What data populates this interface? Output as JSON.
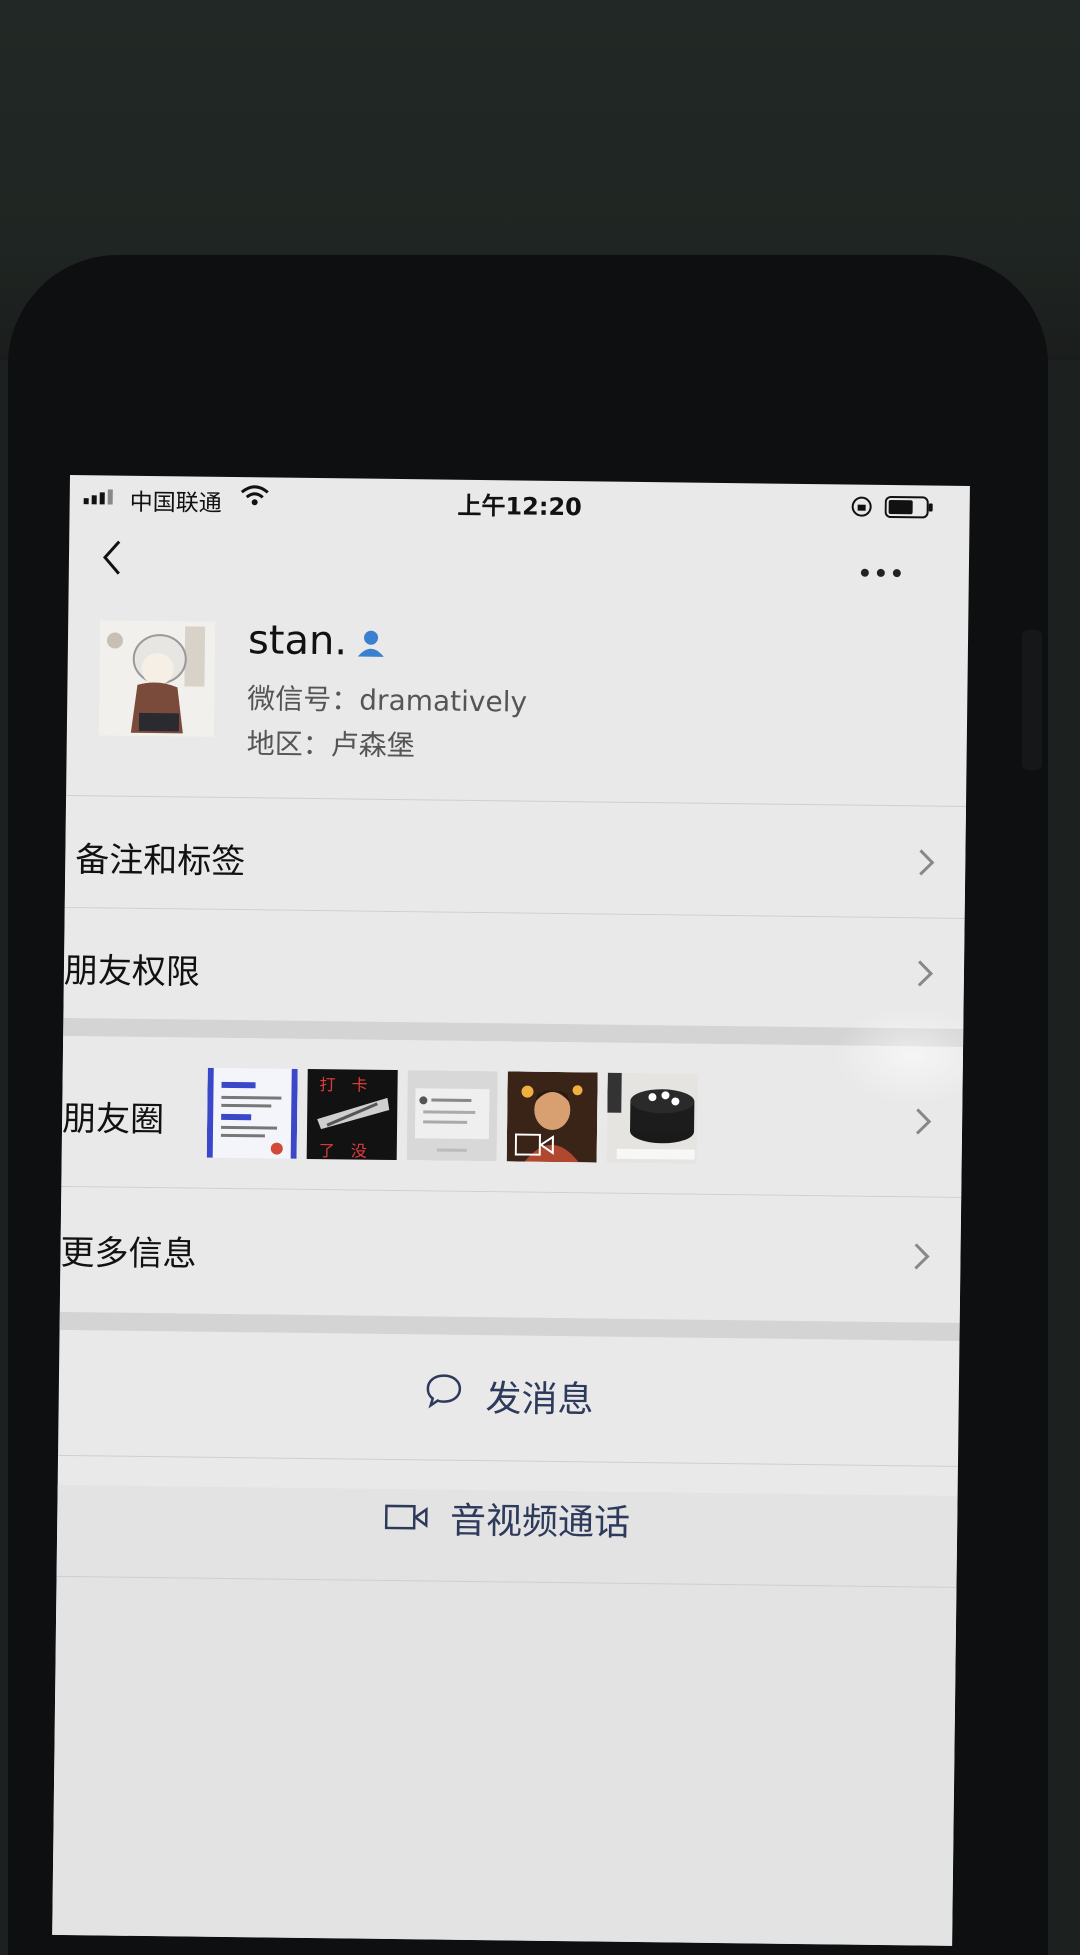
{
  "status_bar": {
    "carrier": "中国联通",
    "time": "上午12:20"
  },
  "profile": {
    "name": "stan.",
    "wechat_id": "微信号：dramatively",
    "region": "地区：卢森堡"
  },
  "menu": {
    "remark_tags": "备注和标签",
    "friend_permissions": "朋友权限",
    "moments": "朋友圈",
    "more_info": "更多信息"
  },
  "moments_thumbs": {
    "thumb2_text_top": "打　卡",
    "thumb2_text_bottom": "了　没"
  },
  "actions": {
    "send_message": "发消息",
    "video_call": "音视频通话"
  },
  "colors": {
    "action_text": "#2e3a5c",
    "verified_icon": "#3b7fd0"
  }
}
